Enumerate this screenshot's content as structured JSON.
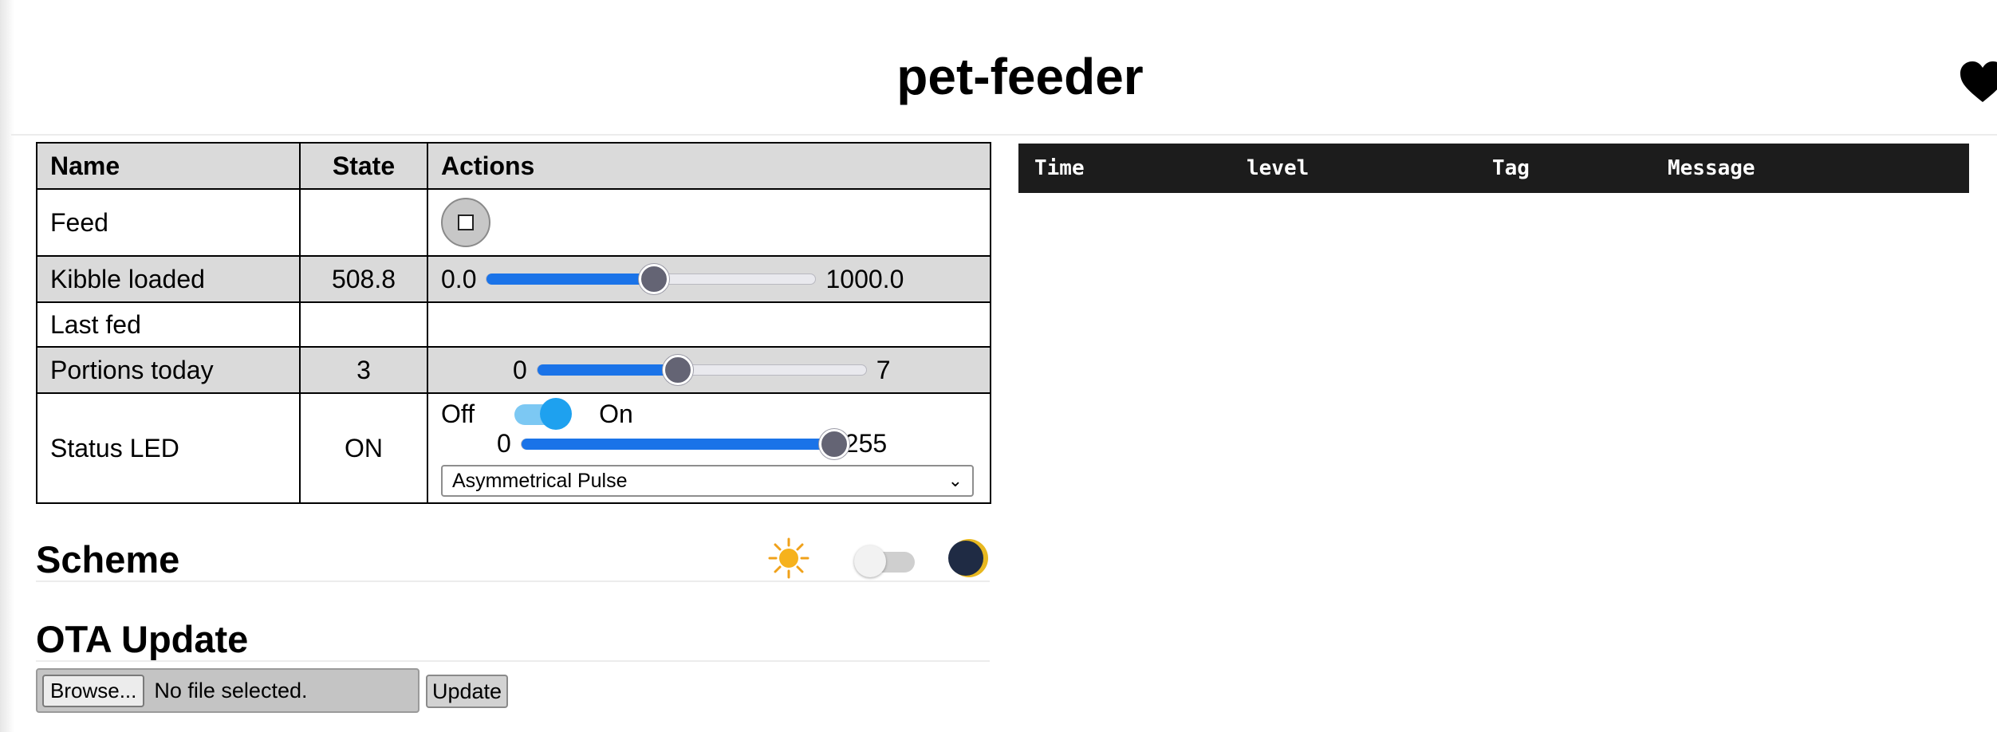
{
  "header": {
    "title": "pet-feeder",
    "heart_icon": "heart-icon"
  },
  "table": {
    "headers": [
      "Name",
      "State",
      "Actions"
    ],
    "rows": [
      {
        "name": "Feed",
        "state": "",
        "action": "button",
        "button_icon": "square-icon"
      },
      {
        "name": "Kibble loaded",
        "state": "508.8",
        "range": {
          "min": "0.0",
          "max": "1000.0",
          "value": 508.8,
          "max_value": 1000
        }
      },
      {
        "name": "Last fed",
        "state": ""
      },
      {
        "name": "Portions today",
        "state": "3",
        "range": {
          "min": "0",
          "max": "7",
          "value": 3,
          "max_value": 7
        }
      },
      {
        "name": "Status LED",
        "state": "ON",
        "toggle": {
          "off_label": "Off",
          "on_label": "On",
          "checked": true
        },
        "range": {
          "min": "0",
          "max": "255",
          "value": 255,
          "max_value": 255
        },
        "select": {
          "selected": "Asymmetrical Pulse"
        }
      }
    ]
  },
  "scheme": {
    "title": "Scheme",
    "light_icon": "sun-icon",
    "dark_icon": "moon-icon",
    "dark_enabled": false
  },
  "ota": {
    "title": "OTA Update",
    "browse_label": "Browse...",
    "file_status": "No file selected.",
    "update_label": "Update"
  },
  "log": {
    "headers": [
      "Time",
      "level",
      "Tag",
      "Message"
    ]
  },
  "colors": {
    "accent": "#1a73e8",
    "toggle_on": "#1ea1ef",
    "header_bg": "#dadada",
    "log_bg": "#1c1c1c"
  }
}
